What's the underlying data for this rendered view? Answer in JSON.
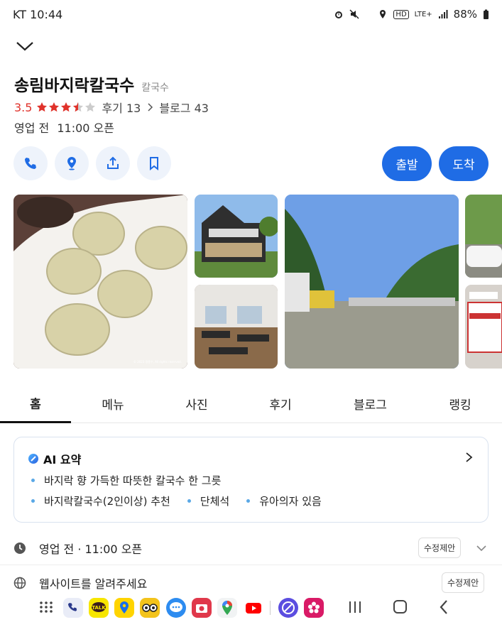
{
  "status": {
    "carrier_time": "KT 10:44",
    "hd": "HD",
    "network": "LTE+",
    "battery": "88%"
  },
  "place": {
    "name": "송림바지락칼국수",
    "category": "칼국수",
    "rating": "3.5",
    "rating_value": 3.5,
    "reviews": "후기 13",
    "blogs": "블로그 43",
    "status": "영업 전",
    "open_time": "11:00 오픈"
  },
  "buttons": {
    "depart": "출발",
    "arrive": "도착"
  },
  "photos": {
    "watermark": "© 2023 정종수, All rights reserved."
  },
  "tabs": [
    "홈",
    "메뉴",
    "사진",
    "후기",
    "블로그",
    "랭킹"
  ],
  "ai_summary": {
    "title": "AI 요약",
    "line1": "바지락 향 가득한 따뜻한 칼국수 한 그릇",
    "item_a": "바지락칼국수(2인이상) 추천",
    "item_b": "단체석",
    "item_c": "유아의자 있음"
  },
  "info": {
    "hours_status": "영업 전 · 11:00 오픈",
    "website": "웹사이트를 알려주세요",
    "edit": "수정제안"
  },
  "colors": {
    "accent": "#1f6ce5",
    "rating": "#e0322b",
    "star_filled": "#e0322b",
    "star_empty": "#cccccc"
  }
}
